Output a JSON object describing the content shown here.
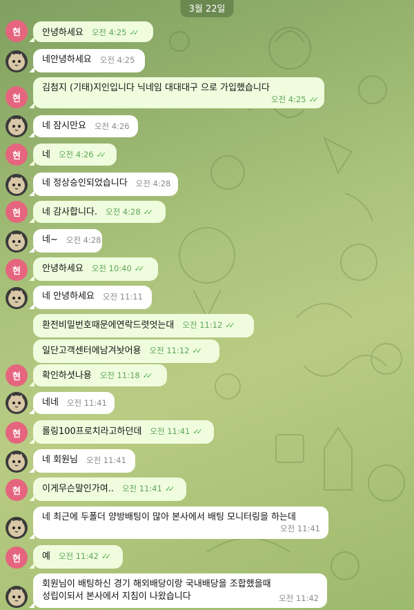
{
  "date_label": "3월 22일",
  "avatar_me_label": "현",
  "messages": [
    {
      "side": "out",
      "text": "안녕하세요",
      "time": "오전 4:25"
    },
    {
      "side": "in",
      "text": "네안녕하세요",
      "time": "오전 4:25"
    },
    {
      "side": "out",
      "text": "김첨지 (기태)지인입니다 닉네임 대대대구 으로 가입했습니다",
      "time": "오전 4:25"
    },
    {
      "side": "in",
      "text": "네 잠시만요",
      "time": "오전 4:26"
    },
    {
      "side": "out",
      "text": "네",
      "time": "오전 4:26"
    },
    {
      "side": "in",
      "text": "네 정상승인되었습니다",
      "time": "오전 4:28"
    },
    {
      "side": "out",
      "text": "네 감사합니다.",
      "time": "오전 4:28"
    },
    {
      "side": "in",
      "text": "네~",
      "time": "오전 4:28"
    },
    {
      "side": "out",
      "text": "안녕하세요",
      "time": "오전 10:40"
    },
    {
      "side": "in",
      "text": "네 안녕하세요",
      "time": "오전 11:11"
    },
    {
      "side": "out",
      "text": "환전비밀번호때문에연락드렷엇는대",
      "time": "오전 11:12"
    },
    {
      "side": "out",
      "text": "일단고객센터에남겨놧어용",
      "time": "오전 11:12"
    },
    {
      "side": "out",
      "text": "확인하셧나용",
      "time": "오전 11:18"
    },
    {
      "side": "in",
      "text": "네네",
      "time": "오전 11:41"
    },
    {
      "side": "out",
      "text": "롤링100프로치라고하던데",
      "time": "오전 11:41"
    },
    {
      "side": "in",
      "text": "네 회원님",
      "time": "오전 11:41"
    },
    {
      "side": "out",
      "text": "이게무슨말인가여..",
      "time": "오전 11:41"
    },
    {
      "side": "in",
      "text": "네 최근에 두폴더 양방배팅이 많아 본사에서 배팅 모니터링을 하는데",
      "time": "오전 11:41"
    },
    {
      "side": "out",
      "text": "예",
      "time": "오전 11:42"
    },
    {
      "side": "in",
      "text": "회원님이 배팅하신 경기 해외배당이랑 국내배당을 조합했을때",
      "text2": "성립이되서 본사에서 지침이 나왔습니다",
      "time": "오전 11:42"
    }
  ]
}
